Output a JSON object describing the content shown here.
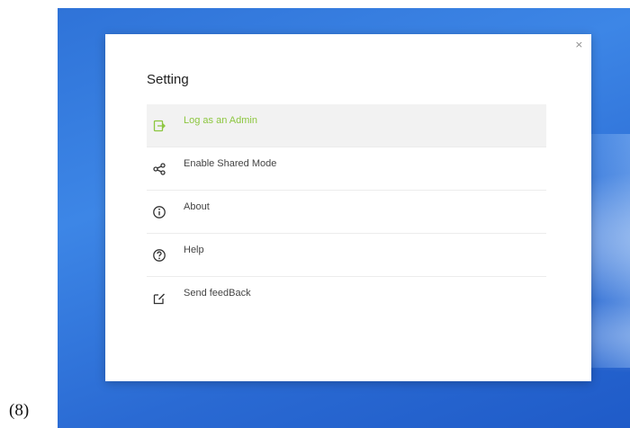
{
  "caption": "(8)",
  "dialog": {
    "close_glyph": "×",
    "title": "Setting",
    "accent_color": "#8cc63f",
    "items": [
      {
        "label": "Log as an Admin",
        "icon": "login-icon",
        "active": true
      },
      {
        "label": "Enable Shared Mode",
        "icon": "share-icon",
        "active": false
      },
      {
        "label": "About",
        "icon": "info-icon",
        "active": false
      },
      {
        "label": "Help",
        "icon": "help-icon",
        "active": false
      },
      {
        "label": "Send feedBack",
        "icon": "feedback-icon",
        "active": false
      }
    ]
  }
}
